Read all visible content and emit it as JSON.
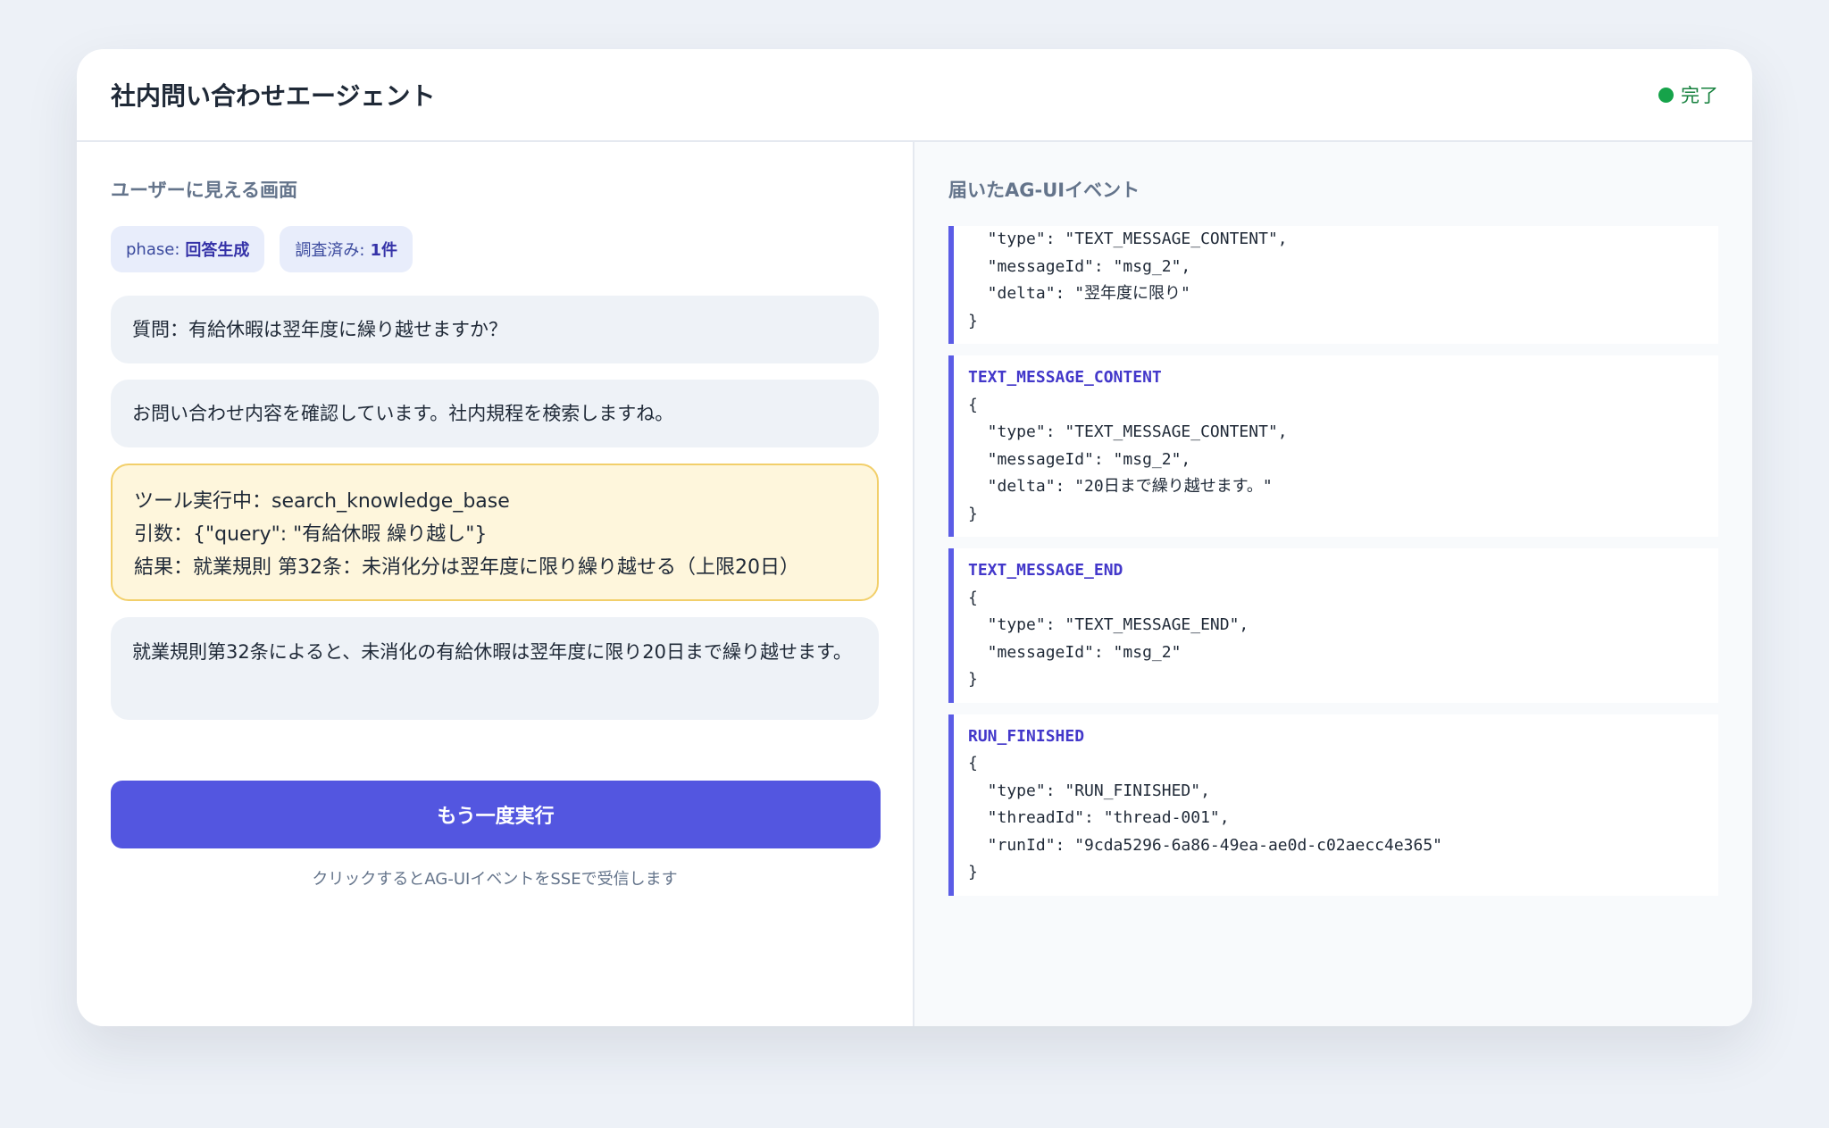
{
  "header": {
    "title": "社内問い合わせエージェント",
    "status_label": "完了",
    "status_color": "#16a34a"
  },
  "left": {
    "section_title": "ユーザーに見える画面",
    "chips": [
      {
        "label": "phase:",
        "value": "回答生成"
      },
      {
        "label": "調査済み:",
        "value": "1件"
      }
    ],
    "messages": {
      "question": "質問：有給休暇は翌年度に繰り越せますか？",
      "ack": "お問い合わせ内容を確認しています。社内規程を検索しますね。",
      "tool_line1": "ツール実行中：search_knowledge_base",
      "tool_line2": "引数：{\"query\": \"有給休暇 繰り越し\"}",
      "tool_line3": "結果：就業規則 第32条：未消化分は翌年度に限り繰り越せる（上限20日）",
      "answer": "就業規則第32条によると、未消化の有給休暇は翌年度に限り20日まで繰り越せます。"
    },
    "run_button": "もう一度実行",
    "hint": "クリックするとAG-UIイベントをSSEで受信します"
  },
  "right": {
    "section_title": "届いたAG-UIイベント",
    "events": [
      {
        "name": "",
        "body": "  \"type\": \"TEXT_MESSAGE_CONTENT\",\n  \"messageId\": \"msg_2\",\n  \"delta\": \"翌年度に限り\"\n}"
      },
      {
        "name": "TEXT_MESSAGE_CONTENT",
        "body": "{\n  \"type\": \"TEXT_MESSAGE_CONTENT\",\n  \"messageId\": \"msg_2\",\n  \"delta\": \"20日まで繰り越せます。\"\n}"
      },
      {
        "name": "TEXT_MESSAGE_END",
        "body": "{\n  \"type\": \"TEXT_MESSAGE_END\",\n  \"messageId\": \"msg_2\"\n}"
      },
      {
        "name": "RUN_FINISHED",
        "body": "{\n  \"type\": \"RUN_FINISHED\",\n  \"threadId\": \"thread-001\",\n  \"runId\": \"9cda5296-6a86-49ea-ae0d-c02aecc4e365\"\n}"
      }
    ]
  }
}
